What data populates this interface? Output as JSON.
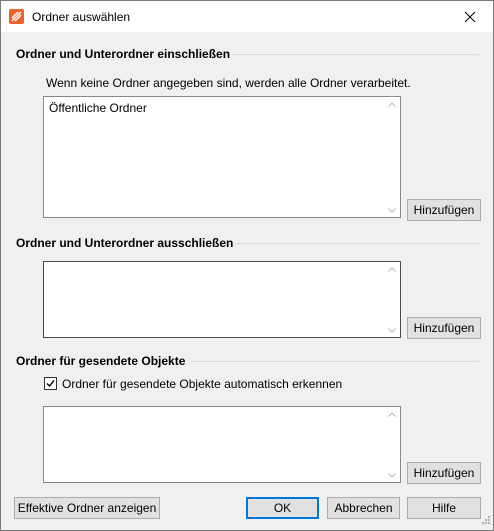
{
  "window": {
    "title": "Ordner auswählen"
  },
  "include_section": {
    "heading": "Ordner und Unterordner einschließen",
    "hint": "Wenn keine Ordner angegeben sind, werden alle Ordner verarbeitet.",
    "items": [
      "Öffentliche Ordner"
    ],
    "add_label": "Hinzufügen"
  },
  "exclude_section": {
    "heading": "Ordner und Unterordner ausschließen",
    "items": [],
    "add_label": "Hinzufügen"
  },
  "sent_section": {
    "heading": "Ordner für gesendete Objekte",
    "auto_detect_label": "Ordner für gesendete Objekte automatisch erkennen",
    "auto_detect_checked": true,
    "items": [],
    "add_label": "Hinzufügen"
  },
  "footer": {
    "effective_label": "Effektive Ordner anzeigen",
    "ok_label": "OK",
    "cancel_label": "Abbrechen",
    "help_label": "Hilfe"
  },
  "colors": {
    "accent": "#0078d7",
    "app_icon": "#e8662a"
  },
  "icons": [
    "app-icon",
    "close-icon",
    "scroll-up-icon",
    "scroll-down-icon",
    "checkmark-icon",
    "resize-grip-icon"
  ]
}
